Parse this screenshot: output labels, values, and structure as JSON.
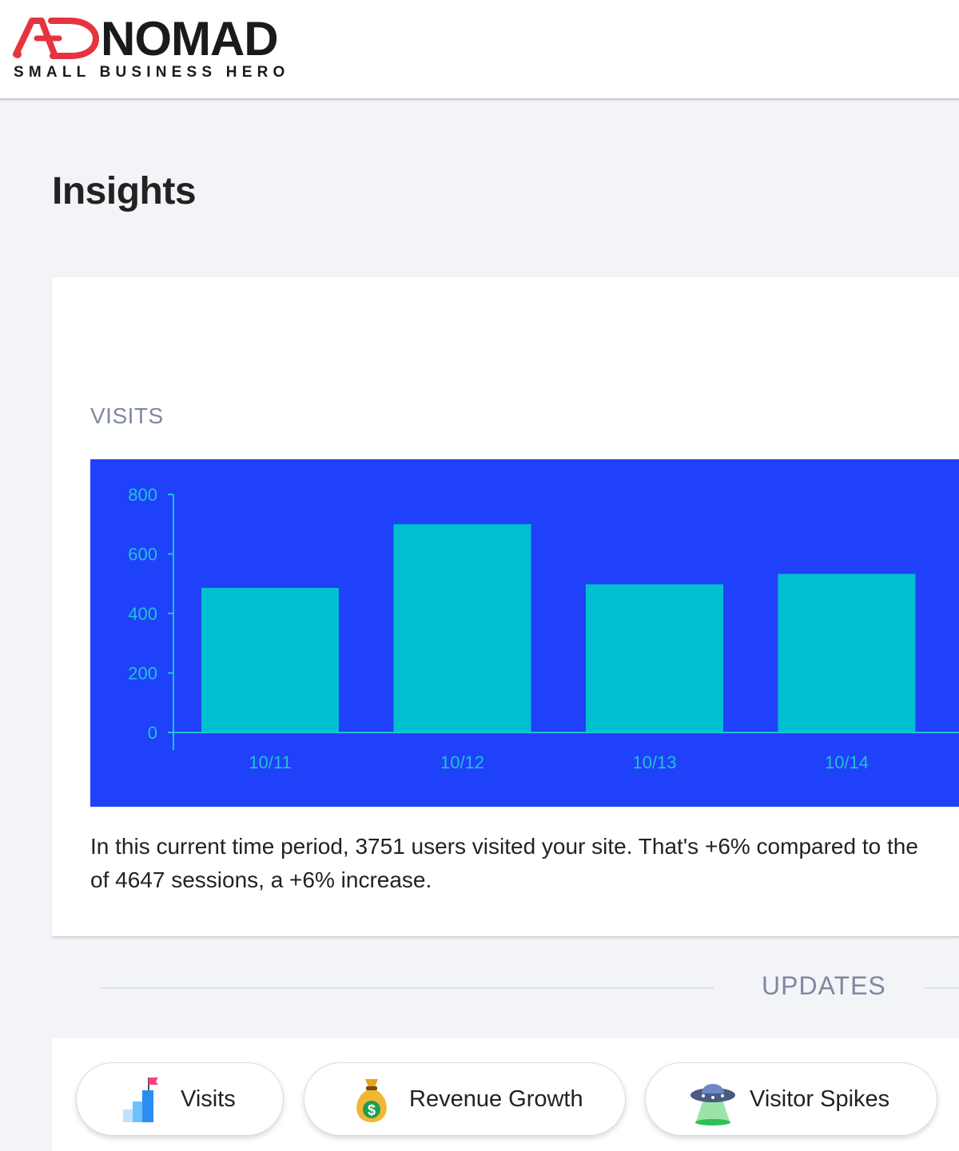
{
  "header": {
    "logo_brand": "NOMAD",
    "logo_tagline": "SMALL BUSINESS HERO",
    "logo_mark_text": "AD"
  },
  "page": {
    "title": "Insights"
  },
  "visits_card": {
    "section_label": "VISITS",
    "summary_line1": "In this current time period, 3751 users visited your site. That's +6% compared to the",
    "summary_line2": "of 4647 sessions, a +6% increase."
  },
  "chart_data": {
    "type": "bar",
    "categories": [
      "10/11",
      "10/12",
      "10/13",
      "10/14"
    ],
    "values": [
      486,
      700,
      498,
      533
    ],
    "ylim": [
      0,
      800
    ],
    "yticks": [
      0,
      200,
      400,
      600,
      800
    ],
    "grid": false,
    "background_color": "#1f41fa",
    "bar_color": "#00bfd1",
    "axis_color": "#20c2d8"
  },
  "updates": {
    "label": "UPDATES",
    "tabs": [
      {
        "label": "Visits",
        "icon": "bar-chart-flag-icon"
      },
      {
        "label": "Revenue Growth",
        "icon": "money-bag-icon"
      },
      {
        "label": "Visitor Spikes",
        "icon": "ufo-icon"
      }
    ]
  },
  "colors": {
    "brand_red": "#e5343f",
    "page_bg": "#f3f4f7",
    "muted_label": "#7e88a0"
  }
}
